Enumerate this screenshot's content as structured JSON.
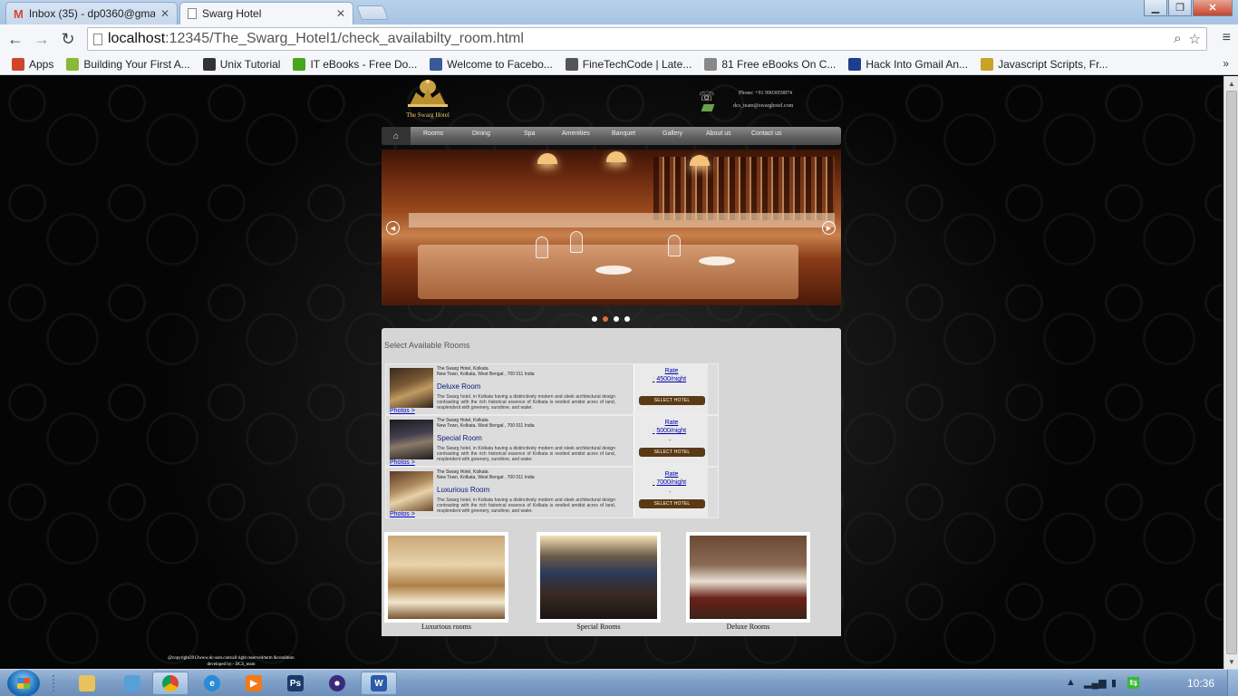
{
  "browser": {
    "tabs": [
      {
        "title": "Inbox (35) - dp0360@gma",
        "icon": "gmail-icon"
      },
      {
        "title": "Swarg Hotel",
        "icon": "page-icon"
      }
    ],
    "url_host": "localhost",
    "url_rest": ":12345/The_Swarg_Hotel1/check_availabilty_room.html",
    "bookmarks": [
      {
        "label": "Apps",
        "icon": "apps-grid-icon",
        "color": "#d0442c"
      },
      {
        "label": "Building Your First A...",
        "icon": "android-icon",
        "color": "#8ab83a"
      },
      {
        "label": "Unix Tutorial",
        "icon": "unix-icon",
        "color": "#333333"
      },
      {
        "label": "IT eBooks - Free Do...",
        "icon": "green-ball-icon",
        "color": "#4aa51c"
      },
      {
        "label": "Welcome to Facebo...",
        "icon": "facebook-icon",
        "color": "#3b5998"
      },
      {
        "label": "FineTechCode | Late...",
        "icon": "ftc-icon",
        "color": "#555555"
      },
      {
        "label": "81 Free eBooks On C...",
        "icon": "page-icon",
        "color": "#888888"
      },
      {
        "label": "Hack Into Gmail An...",
        "icon": "efy-icon",
        "color": "#1d3f8c"
      },
      {
        "label": "Javascript Scripts, Fr...",
        "icon": "js-icon",
        "color": "#c9a227"
      }
    ],
    "more": "»"
  },
  "site": {
    "logo_name": "The Swarg Hotel",
    "phone": "Phone: +91 9903059874",
    "email": "dcs_team@swarghotel.com",
    "nav": [
      "Rooms",
      "Dining",
      "Spa",
      "Amenities",
      "Banquet",
      "Gallery",
      "About us",
      "Contact us"
    ],
    "slider_dots": 4,
    "slider_active_dot": 1
  },
  "panel": {
    "heading": "Select Available Rooms",
    "rooms": [
      {
        "address1": "The Swarg Hotel, Kolkata",
        "address2": "New Town, Kolkata, West Bengal , 700 011 India",
        "name": "Deluxe Room",
        "description": "The Swarg hotel, in Kolkata having a distinctively modern and sleek architectural design contrasting with the rich historical essence of Kolkata is nestled amidst acres of land, resplendent with greenery, sunshine, and water.",
        "photos": "Photos >",
        "rate_label": "Rate",
        "price": "4500/night",
        "select": "SELECT HOTEL"
      },
      {
        "address1": "The Swarg Hotel, Kolkata",
        "address2": "New Town, Kolkata, West Bengal , 700 011 India",
        "name": "Special Room",
        "description": "The Swarg hotel, in Kolkata having a distinctively modern and sleek architectural design contrasting with the rich historical essence of Kolkata is nestled amidst acres of land, resplendent with greenery, sunshine, and water.",
        "photos": "Photos >",
        "rate_label": "Rate",
        "price": "5000/night",
        "select": "SELECT HOTEL"
      },
      {
        "address1": "The Swarg Hotel, Kolkata",
        "address2": "New Town, Kolkata, West Bengal , 700 011 India",
        "name": "Luxurious Room",
        "description": "The Swarg hotel, in Kolkata having a distinctively modern and sleek architectural design contrasting with the rich historical essence of Kolkata is nestled amidst acres of land, resplendent with greenery, sunshine, and water.",
        "photos": "Photos >",
        "rate_label": "Rate",
        "price": "7000/night",
        "select": "SELECT HOTEL"
      }
    ],
    "gallery": [
      "Luxurious rooms",
      "Special Rooms",
      "Deluxe Rooms"
    ]
  },
  "footer": {
    "line1": "@copyright2012www.dc-ssm.com/all right reserved/term &condition",
    "line2": "developed by:- DCS_team"
  },
  "taskbar": {
    "clock": "10:36",
    "apps": [
      "explorer",
      "windows-explorer",
      "chrome",
      "internet-explorer",
      "media-player",
      "photoshop",
      "eclipse",
      "word"
    ]
  }
}
